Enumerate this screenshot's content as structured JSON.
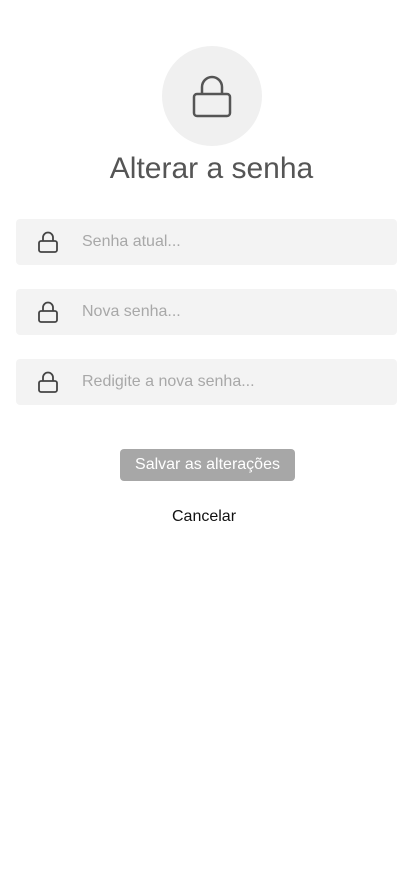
{
  "header": {
    "icon": "lock-icon",
    "title": "Alterar a senha"
  },
  "form": {
    "fields": [
      {
        "icon": "lock-icon",
        "placeholder": "Senha atual...",
        "value": ""
      },
      {
        "icon": "lock-icon",
        "placeholder": "Nova senha...",
        "value": ""
      },
      {
        "icon": "lock-icon",
        "placeholder": "Redigite a nova senha...",
        "value": ""
      }
    ],
    "save_label": "Salvar as alterações",
    "cancel_label": "Cancelar"
  },
  "colors": {
    "title": "#555555",
    "field_background": "#f3f3f3",
    "placeholder": "#a8a8a8",
    "save_button_disabled": "#a7a7a7",
    "icon_circle": "#f0f0f0"
  }
}
